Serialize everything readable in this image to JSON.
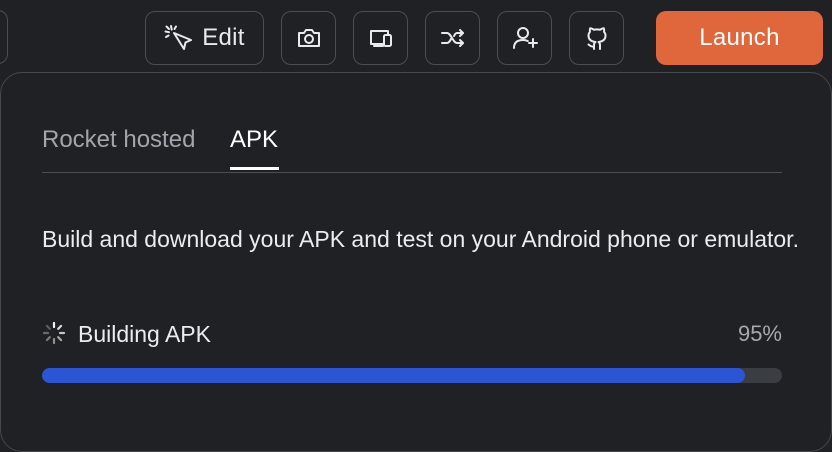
{
  "toolbar": {
    "edit_label": "Edit",
    "launch_label": "Launch",
    "icons": [
      "pointer-click-icon",
      "camera-icon",
      "devices-icon",
      "shuffle-icon",
      "user-plus-icon",
      "github-icon"
    ]
  },
  "tabs": [
    {
      "label": "Rocket hosted",
      "active": false
    },
    {
      "label": "APK",
      "active": true
    }
  ],
  "content": {
    "description": "Build and download your APK and test on your Android phone or emulator.",
    "status_label": "Building APK",
    "progress_text": "95%",
    "progress_value": 95
  },
  "colors": {
    "launch_bg": "#e0663b",
    "progress_fill": "#2a56d6",
    "background": "#1f2124"
  }
}
